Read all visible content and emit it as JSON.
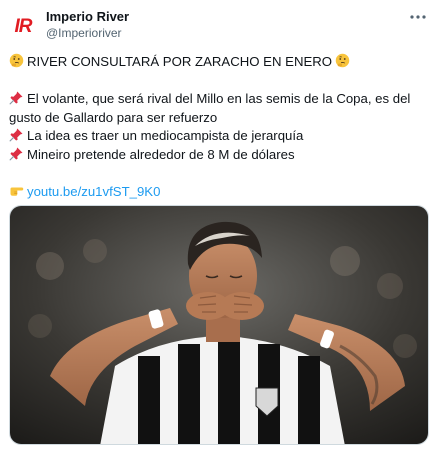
{
  "account": {
    "display_name": "Imperio River",
    "handle": "@Imperioriver",
    "avatar_text": "IR"
  },
  "tweet": {
    "headline": "RIVER CONSULTARÁ POR ZARACHO EN ENERO",
    "paragraphs": [
      "El volante, que será rival del Millo en las semis de la Copa, es del gusto de Gallardo para ser refuerzo",
      "La idea es traer un mediocampista de jerarquía",
      "Mineiro pretende alrededor de 8 M de dólares"
    ],
    "link_text": "youtu.be/zu1vfST_9K0"
  },
  "icons": {
    "thinking": "thinking-face-icon",
    "pin": "pushpin-icon",
    "pointer": "backhand-index-pointing-right-icon",
    "more": "more-horizontal-icon"
  },
  "colors": {
    "brand_red": "#e11b22",
    "link_blue": "#1d9bf0",
    "secondary_text": "#536471"
  }
}
